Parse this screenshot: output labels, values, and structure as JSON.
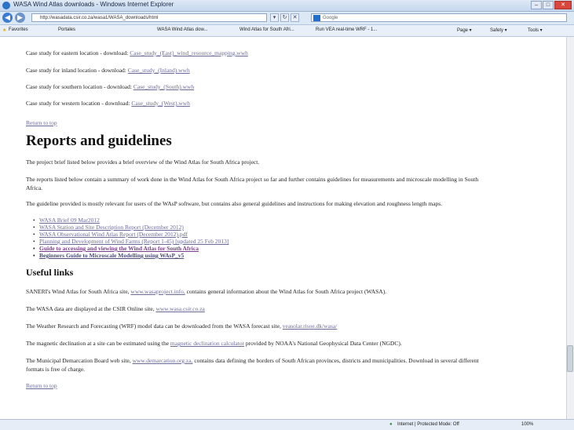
{
  "window": {
    "title": "WASA Wind Atlas downloads - Windows Internet Explorer",
    "controls": [
      "–",
      "□",
      "✕"
    ]
  },
  "nav": {
    "back": "◀",
    "forward": "▶",
    "url": "http://wasadata.csir.co.za/wasa1/WASA_downloads/html",
    "buttons": [
      "▾",
      "↻",
      "✕"
    ],
    "search_placeholder": "Google"
  },
  "favorites_bar": {
    "favorites": "Favorites",
    "portal": "Portales",
    "tabs": [
      "WASA Wind Atlas dow...",
      "Wind Atlas for South Afri...",
      "Run VEA real-time WRF - 1..."
    ],
    "tools": [
      "Page ▾",
      "Safety ▾",
      "Tools ▾"
    ]
  },
  "case_studies": [
    {
      "text": "Case study for eastern location - download:",
      "link": "Case_study_(East)_wind_resource_mapping.wwh"
    },
    {
      "text": "Case study for inland location - download:",
      "link": "Case_study_(Inland).wwh"
    },
    {
      "text": "Case study for southern location - download:",
      "link": "Case_study_(South).wwh"
    },
    {
      "text": "Case study for western location - download:",
      "link": "Case_study_(West).wwh"
    }
  ],
  "return_top": "Return to top",
  "reports": {
    "heading": "Reports and guidelines",
    "para1": "The project brief listed below provides a brief overview of the Wind Atlas for South Africa project.",
    "para2a": "The reports listed below contain a summary of work done in the Wind Atlas for South Africa project so far and further contains guidelines for measurements and microscale modelling in South",
    "para2b": "Africa.",
    "para3": "The guideline provided is mostly relevant for users of the WAsP software, but contains also general guidelines and instructions for making elevation and roughness length maps.",
    "items": [
      "WASA Brief 09 Mar2012",
      "WASA Station and Site Description Report (December 2012)",
      "WASA Observational Wind Atlas Report (December 2012).pdf",
      "Planning and Development of Wind Farms (Report 1-45) [updated 25 Feb 2013]",
      "Guide to accessing and viewing the Wind Atlas for South Africa",
      "Beginners Guide to Microscale Modelling using WAsP_v5"
    ]
  },
  "useful": {
    "heading": "Useful links",
    "l1a": "SANERI's Wind Atlas for South Africa site,",
    "l1link": "www.wasaproject.info,",
    "l1b": "contains general information about the Wind Atlas for South Africa project (WASA).",
    "l2a": "The WASA data are displayed at the CSIR Online site,",
    "l2link": "www.wasa.csir.co.za",
    "l3a": "The Weather Research and Forecasting (WRF) model data can be downloaded from the WASA forecast site,",
    "l3link": "veasolar.risoe.dk/wasa/",
    "l4a": "The magnetic declination at a site can be estimated using the",
    "l4link": "magnetic declination calculator",
    "l4b": "provided by NOAA's National Geophysical Data Center (NGDC).",
    "l5a": "The Municipal Demarcation Board web site,",
    "l5link": "www.demarcation.org.za,",
    "l5b": "contains data defining the borders of South African provinces, districts and municipalities. Download in several different",
    "l5c": "formats is free of charge."
  },
  "status": {
    "zone": "Internet | Protected Mode: Off",
    "zoom": "100%"
  }
}
